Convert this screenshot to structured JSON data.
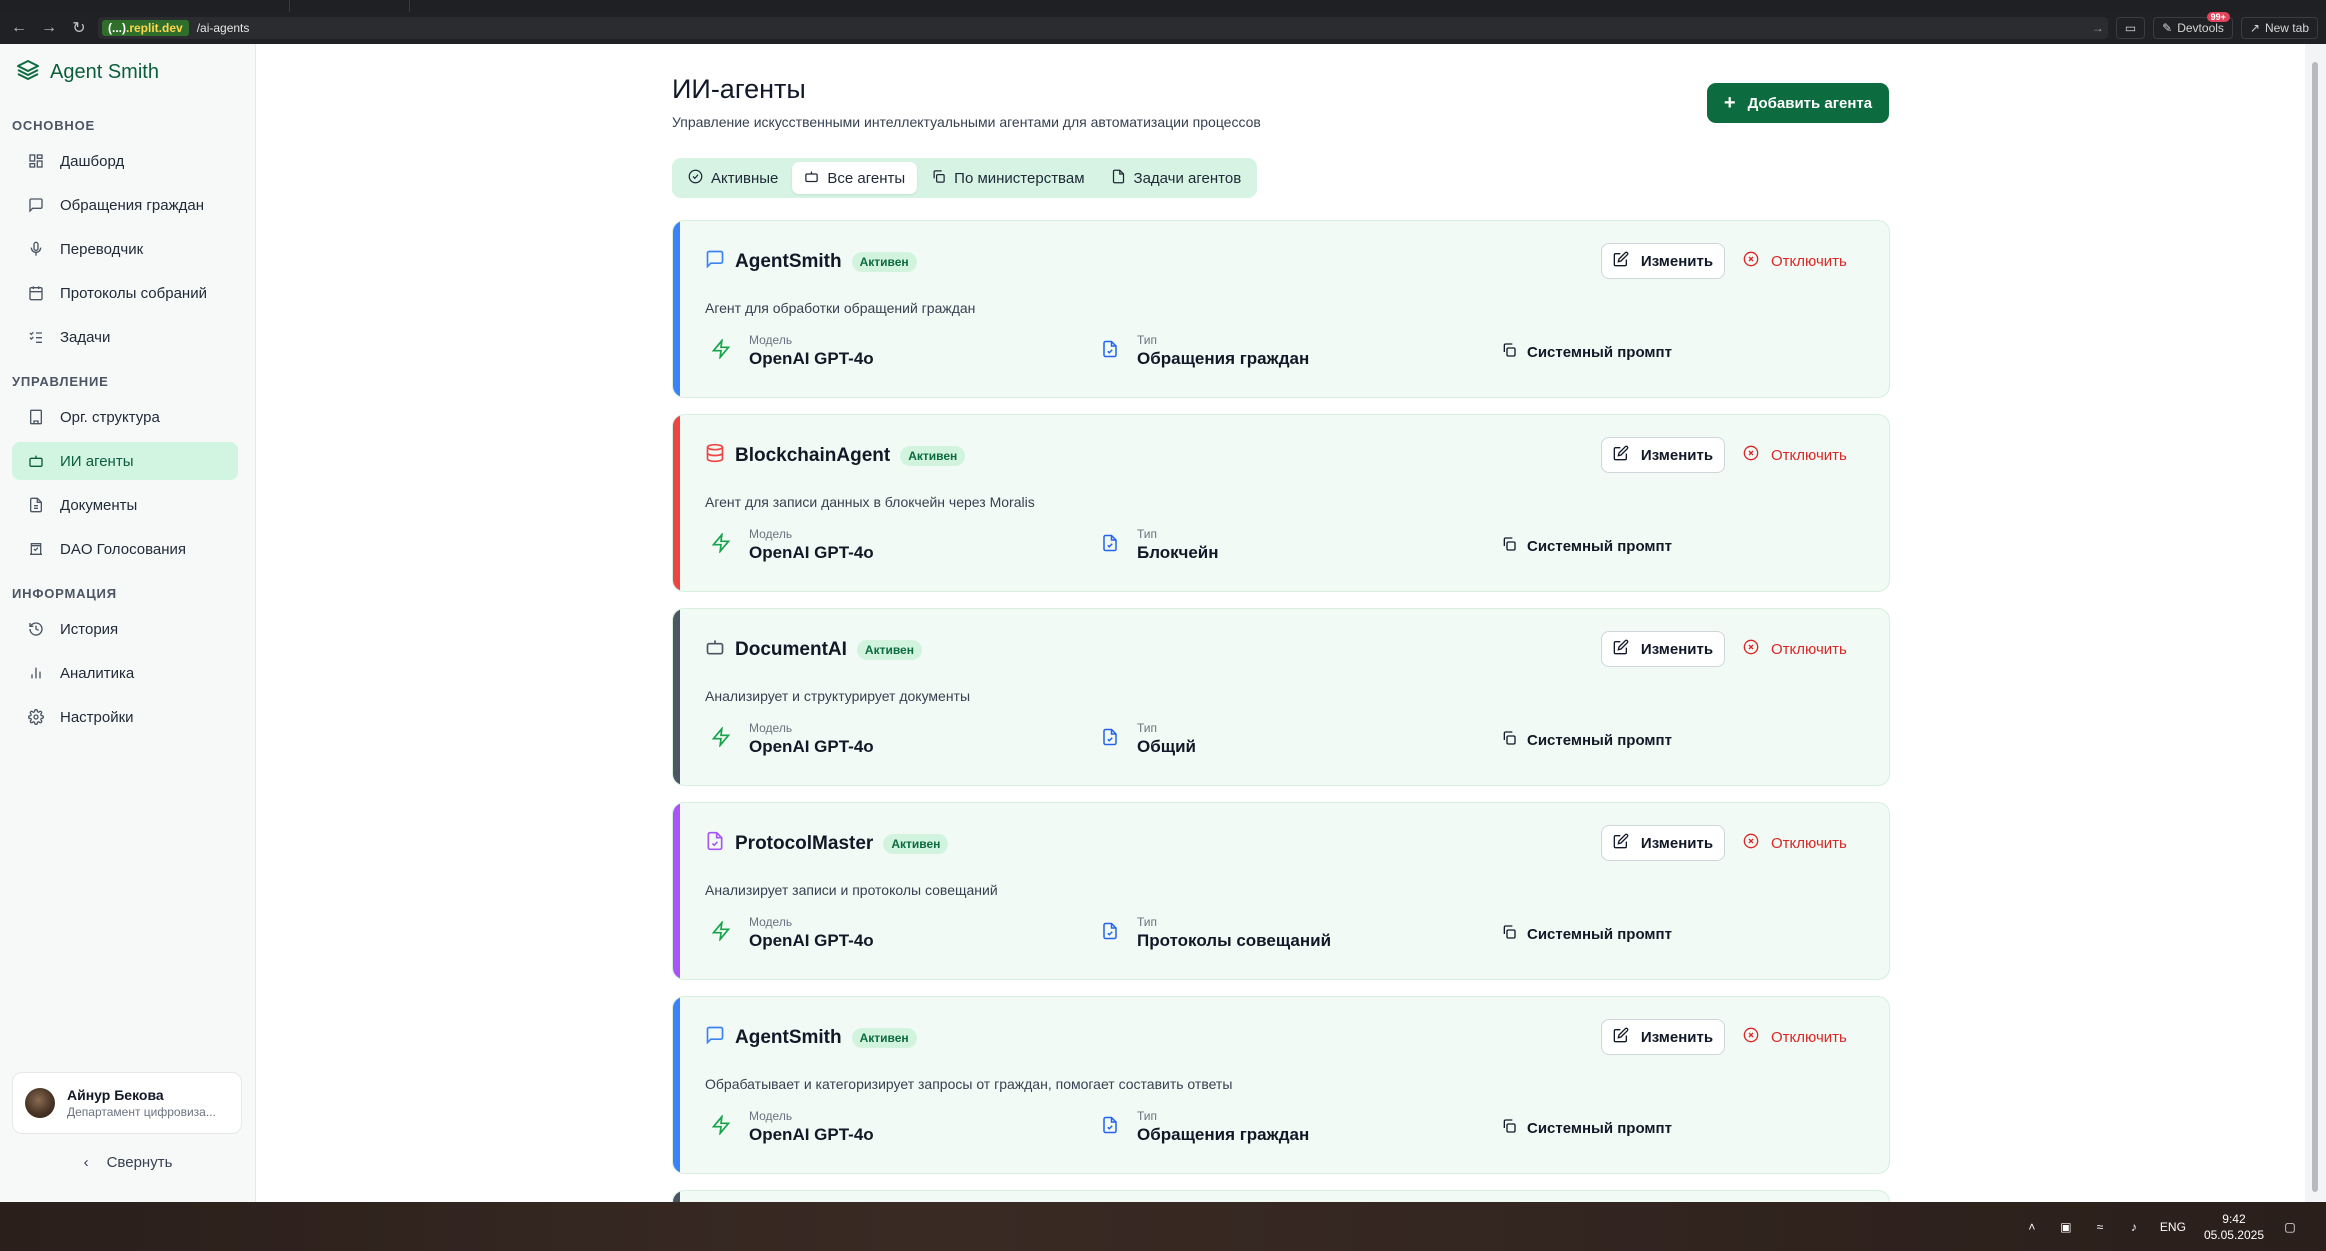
{
  "browser": {
    "url_host_prefix": "(...)",
    "url_host_suffix": ".replit.dev",
    "url_path": "/ai-agents",
    "devtools_label": "Devtools",
    "devtools_badge": "99+",
    "new_tab_label": "New tab"
  },
  "sidebar": {
    "brand": "Agent Smith",
    "sections": [
      {
        "label": "ОСНОВНОЕ"
      },
      {
        "label": "УПРАВЛЕНИЕ"
      },
      {
        "label": "ИНФОРМАЦИЯ"
      }
    ],
    "items": [
      {
        "label": "Дашборд",
        "icon": "dashboard-icon"
      },
      {
        "label": "Обращения граждан",
        "icon": "message-icon"
      },
      {
        "label": "Переводчик",
        "icon": "mic-icon"
      },
      {
        "label": "Протоколы собраний",
        "icon": "calendar-icon"
      },
      {
        "label": "Задачи",
        "icon": "checklist-icon"
      },
      {
        "label": "Орг. структура",
        "icon": "building-icon"
      },
      {
        "label": "ИИ агенты",
        "icon": "bot-icon",
        "active": true
      },
      {
        "label": "Документы",
        "icon": "document-icon"
      },
      {
        "label": "DAO Голосования",
        "icon": "vote-icon"
      },
      {
        "label": "История",
        "icon": "history-icon"
      },
      {
        "label": "Аналитика",
        "icon": "chart-icon"
      },
      {
        "label": "Настройки",
        "icon": "gear-icon"
      }
    ],
    "user": {
      "name": "Айнур Бекова",
      "department": "Департамент цифровиза..."
    },
    "collapse_label": "Свернуть"
  },
  "main": {
    "title": "ИИ-агенты",
    "subtitle": "Управление искусственными интеллектуальными агентами для автоматизации процессов",
    "add_button": "Добавить агента",
    "tabs": [
      {
        "label": "Активные",
        "icon": "check-circle-icon"
      },
      {
        "label": "Все агенты",
        "icon": "bot-icon",
        "active": true
      },
      {
        "label": "По министерствам",
        "icon": "copy-icon"
      },
      {
        "label": "Задачи агентов",
        "icon": "file-icon"
      }
    ],
    "labels": {
      "model": "Модель",
      "type": "Тип",
      "edit": "Изменить",
      "disable": "Отключить",
      "system_prompt": "Системный промпт"
    },
    "agents": [
      {
        "name": "AgentSmith",
        "status": "Активен",
        "description": "Агент для обработки обращений граждан",
        "model": "OpenAI GPT-4o",
        "type": "Обращения граждан",
        "accent": "#3b82f6",
        "icon": "message-icon"
      },
      {
        "name": "BlockchainAgent",
        "status": "Активен",
        "description": "Агент для записи данных в блокчейн через Moralis",
        "model": "OpenAI GPT-4o",
        "type": "Блокчейн",
        "accent": "#ef4444",
        "icon": "database-icon"
      },
      {
        "name": "DocumentAI",
        "status": "Активен",
        "description": "Анализирует и структурирует документы",
        "model": "OpenAI GPT-4o",
        "type": "Общий",
        "accent": "#4b5563",
        "icon": "bot-icon"
      },
      {
        "name": "ProtocolMaster",
        "status": "Активен",
        "description": "Анализирует записи и протоколы совещаний",
        "model": "OpenAI GPT-4o",
        "type": "Протоколы совещаний",
        "accent": "#a855f7",
        "icon": "document-icon"
      },
      {
        "name": "AgentSmith",
        "status": "Активен",
        "description": "Обрабатывает и категоризирует запросы от граждан, помогает составить ответы",
        "model": "OpenAI GPT-4o",
        "type": "Обращения граждан",
        "accent": "#3b82f6",
        "icon": "message-icon"
      }
    ]
  },
  "taskbar": {
    "language": "ENG",
    "time": "9:42",
    "date": "05.05.2025"
  }
}
